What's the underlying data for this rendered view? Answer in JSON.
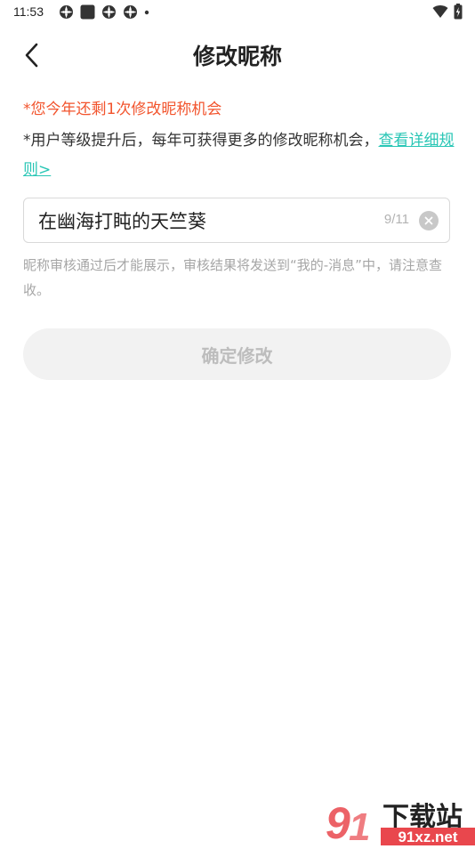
{
  "status_bar": {
    "time": "11:53",
    "left_icons": [
      "app-notification-icon",
      "app-square-icon",
      "app-notification-icon",
      "app-notification-icon",
      "more-dot-icon"
    ],
    "right_icons": [
      "wifi-icon",
      "battery-charging-icon"
    ]
  },
  "header": {
    "title": "修改昵称",
    "back_icon": "chevron-left-icon"
  },
  "notices": {
    "quota": "*您今年还剩1次修改昵称机会",
    "rules_prefix": "*用户等级提升后，每年可获得更多的修改昵称机会，",
    "rules_link": "查看详细规则>"
  },
  "nickname_field": {
    "value": "在幽海打盹的天竺葵",
    "counter": "9/11",
    "clear_icon": "clear-circle-icon"
  },
  "review_hint": "昵称审核通过后才能展示，审核结果将发送到“我的-消息”中，请注意查收。",
  "confirm_button": {
    "label": "确定修改",
    "state": "disabled"
  },
  "watermark": {
    "text_main": "下载站",
    "text_domain": "91xz.net"
  },
  "colors": {
    "notice_red": "#f2542d",
    "link_teal": "#28c6b5",
    "hint_gray": "#a6a6a6",
    "button_disabled_bg": "#f2f2f2",
    "button_disabled_text": "#bdbdbd"
  }
}
